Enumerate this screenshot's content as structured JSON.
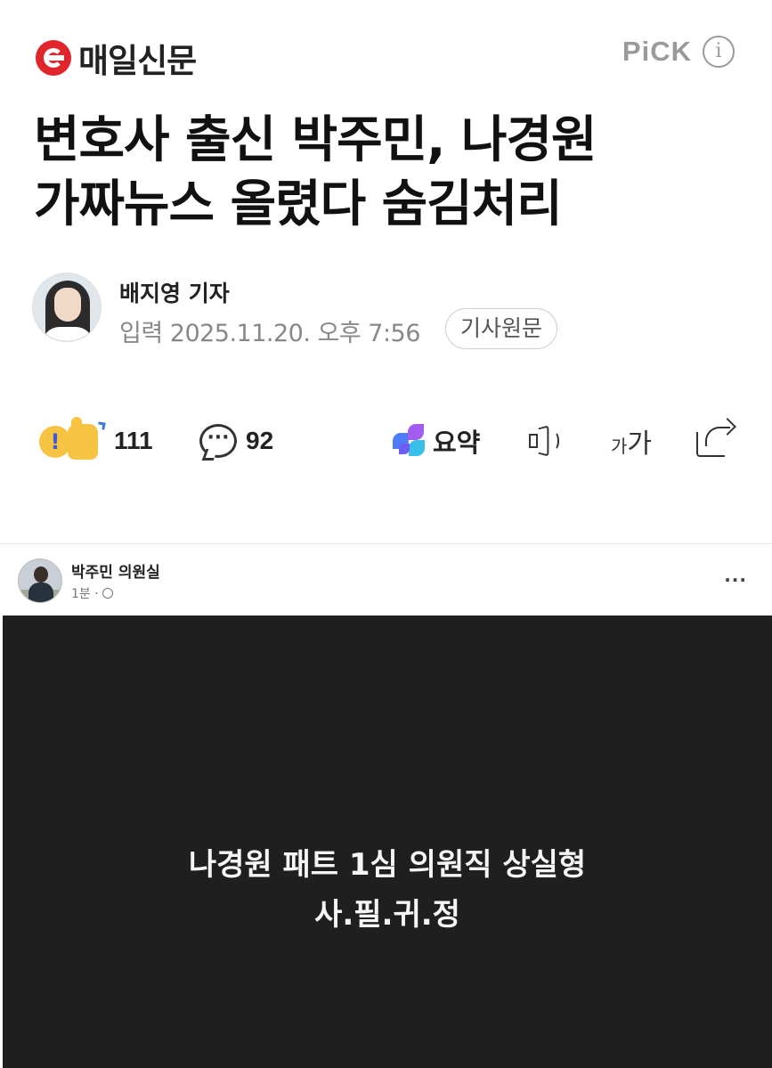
{
  "header": {
    "brand": "매일신문",
    "pick": "PiCK",
    "info_icon": "i"
  },
  "article": {
    "headline_line1": "변호사 출신 박주민, 나경원",
    "headline_line2": "가짜뉴스 올렸다 숨김처리",
    "reporter": "배지영 기자",
    "date": "입력 2025.11.20. 오후 7:56",
    "source_button": "기사원문"
  },
  "actions": {
    "reaction_count": "111",
    "comment_count": "92",
    "comment_icon_glyph": "···",
    "summary_label": "요약",
    "fontsize_small": "가",
    "fontsize_large": "가"
  },
  "embed": {
    "page_name": "박주민 의원실",
    "meta": "1분 · ",
    "menu": "···",
    "media_line1": "나경원 패트 1심 의원직 상실형",
    "media_line2": "사.필.귀.정"
  },
  "colors": {
    "brand_red": "#e0252c",
    "pick_gray": "#9a9a9a",
    "media_bg": "#1f1f1f"
  }
}
